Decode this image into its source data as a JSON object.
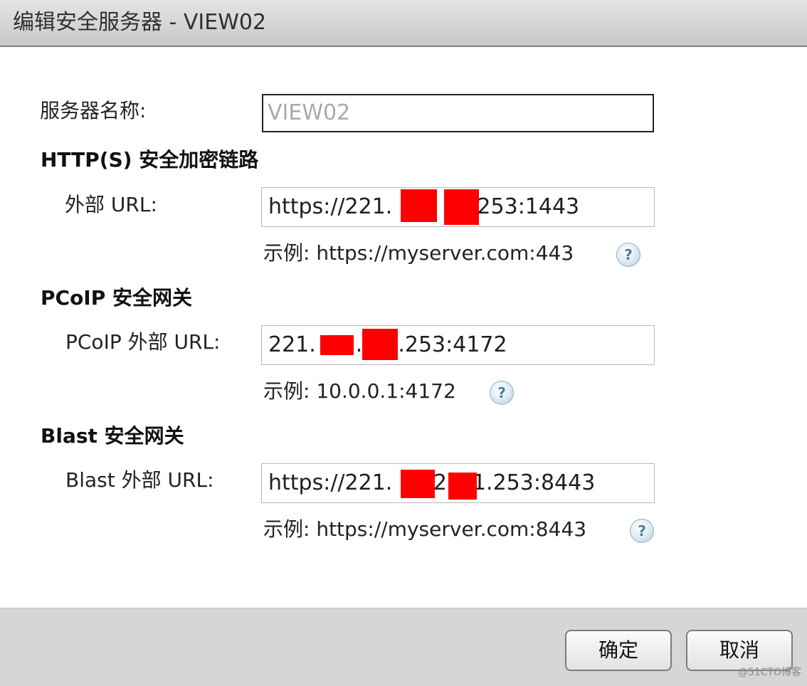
{
  "window": {
    "title": "编辑安全服务器 - VIEW02"
  },
  "server_name": {
    "label": "服务器名称:",
    "value": "VIEW02"
  },
  "https_section": {
    "title": "HTTP(S) 安全加密链路",
    "field_label": "外部 URL:",
    "value_prefix": "https://221.",
    "value_mid": ".",
    "value_suffix": ".253:1443",
    "hint": "示例: https://myserver.com:443"
  },
  "pcoip_section": {
    "title": "PCoIP 安全网关",
    "field_label": "PCoIP 外部 URL:",
    "value_prefix": "221.",
    "value_mid": ".",
    "value_suffix": ".253:4172",
    "hint": "示例: 10.0.0.1:4172"
  },
  "blast_section": {
    "title": "Blast 安全网关",
    "field_label": "Blast 外部 URL:",
    "value_prefix": "https://221.",
    "value_mid": ".2",
    "value_suffix": "1.253:8443",
    "hint": "示例: https://myserver.com:8443"
  },
  "help_icon": {
    "glyph": "?"
  },
  "buttons": {
    "ok": "确定",
    "cancel": "取消"
  },
  "watermark": "@51CTO博客",
  "colors": {
    "redaction": "#ff0000",
    "footer": "#d6d6d6",
    "help_icon": "#4a7f9e"
  }
}
